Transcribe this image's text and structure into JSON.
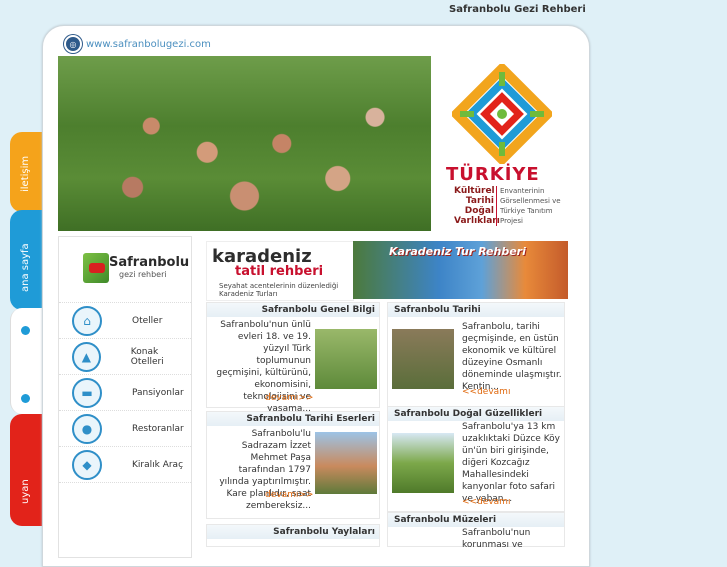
{
  "page_title": "Safranbolu Gezi Rehberi",
  "site_url": "www.safranbolugezi.com",
  "side_tabs": [
    "iletişim",
    "ana sayfa",
    "uyan"
  ],
  "turkiye_logo": {
    "word": "TÜRKİYE",
    "left_lines": [
      "Kültürel",
      "Tarihi",
      "Doğal",
      "Varlıkları"
    ],
    "right_lines": [
      "Envanterinin",
      "Görsellenmesi ve",
      "Türkiye Tanıtım",
      "Projesi"
    ]
  },
  "safranbolu_logo": {
    "title": "Safranbolu",
    "subtitle": "gezi rehberi"
  },
  "menu": [
    {
      "label": "Oteller",
      "icon": "hotel-icon"
    },
    {
      "label": "Konak Otelleri",
      "icon": "mansion-icon"
    },
    {
      "label": "Pansiyonlar",
      "icon": "bed-icon"
    },
    {
      "label": "Restoranlar",
      "icon": "dining-icon"
    },
    {
      "label": "Kiralık Araç",
      "icon": "car-icon"
    }
  ],
  "karadeniz": {
    "title": "karadeniz",
    "subtitle": "tatil rehberi",
    "caption": "Seyahat acentelerinin düzenlediği Karadeniz Turları",
    "banner": "Karadeniz Tur Rehberi"
  },
  "articles": {
    "genel": {
      "title": "Safranbolu Genel Bilgi",
      "text": "Safranbolu'nun ünlü evleri 18. ve 19. yüzyıl Türk toplumunun geçmişini, kültürünü, ekonomisini, teknolojisini ve yaşama...",
      "more": "devamı>>"
    },
    "tarihi": {
      "title": "Safranbolu Tarihi",
      "text": "Safranbolu, tarihi geçmişinde, en üstün ekonomik ve kültürel düzeyine Osmanlı döneminde ulaşmıştır. Kentin...",
      "more": "<<devamı"
    },
    "eserler": {
      "title": "Safranbolu Tarihi Eserleri",
      "text": "Safranbolu'lu Sadrazam İzzet Mehmet Paşa tarafından 1797 yılında yaptırılmıştır. Kare planlıdır, saat zembereksiz...",
      "more": "devamı>>"
    },
    "dogal": {
      "title": "Safranbolu Doğal Güzellikleri",
      "text": "Safranbolu'ya 13 km uzaklıktaki Düzce Köy ün'ün biri girişinde, diğeri Kozcağız Mahallesindeki kanyonlar foto safari ve yaban...",
      "more": "<<devamı"
    },
    "yaylalar": {
      "title": "Safranbolu Yaylaları"
    },
    "muzeler": {
      "title": "Safranbolu Müzeleri",
      "text": "Safranbolu'nun korunması ve"
    }
  }
}
